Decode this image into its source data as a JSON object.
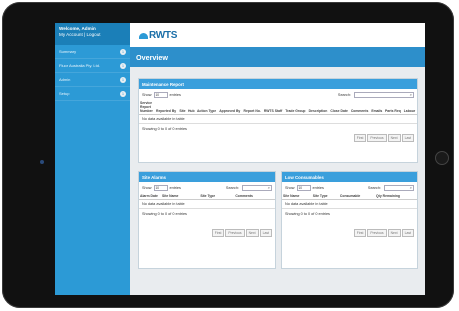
{
  "sidebar": {
    "welcome": "Welcome, Admin",
    "links": "My Account | Logout",
    "items": [
      {
        "label": "Summary",
        "badge": "1"
      },
      {
        "label": "Fluor Australia Pty. Ltd.",
        "badge": "1"
      },
      {
        "label": "Admin",
        "badge": "1"
      },
      {
        "label": "Setup",
        "badge": "1"
      }
    ]
  },
  "header": {
    "logo": "RWTS",
    "title": "Overview"
  },
  "maintenance": {
    "title": "Maintenance Report",
    "show_label": "Show",
    "entries_value": "10",
    "entries_label": "entries",
    "search_label": "Search:",
    "columns": [
      "Service Report Number",
      "Reported By",
      "Site",
      "Hub",
      "Action Type",
      "Approved By",
      "Report No.",
      "RWTS Staff",
      "Trade Group",
      "Description",
      "Close Date",
      "Comments",
      "Emails",
      "Parts Req",
      "Labour"
    ],
    "no_data": "No data available in table",
    "showing": "Showing 0 to 0 of 0 entries",
    "pager": [
      "First",
      "Previous",
      "Next",
      "Last"
    ]
  },
  "site_alarms": {
    "title": "Site Alarms",
    "show_label": "Show",
    "entries_value": "10",
    "entries_label": "entries",
    "search_label": "Search:",
    "columns": [
      "Alarm Date",
      "Site Name",
      "Site Type",
      "Comments"
    ],
    "no_data": "No data available in table",
    "showing": "Showing 0 to 0 of 0 entries",
    "pager": [
      "First",
      "Previous",
      "Next",
      "Last"
    ]
  },
  "low_consumables": {
    "title": "Low Consumables",
    "show_label": "Show",
    "entries_value": "10",
    "entries_label": "entries",
    "search_label": "Search:",
    "columns": [
      "Site Name",
      "Site Type",
      "Consumable",
      "Qty Remaining"
    ],
    "no_data": "No data available in table",
    "showing": "Showing 0 to 0 of 0 entries",
    "pager": [
      "First",
      "Previous",
      "Next",
      "Last"
    ]
  },
  "colors": {
    "accent": "#2c9ad6",
    "header": "#3a9fdc",
    "title_bar": "#2d8fcb"
  }
}
